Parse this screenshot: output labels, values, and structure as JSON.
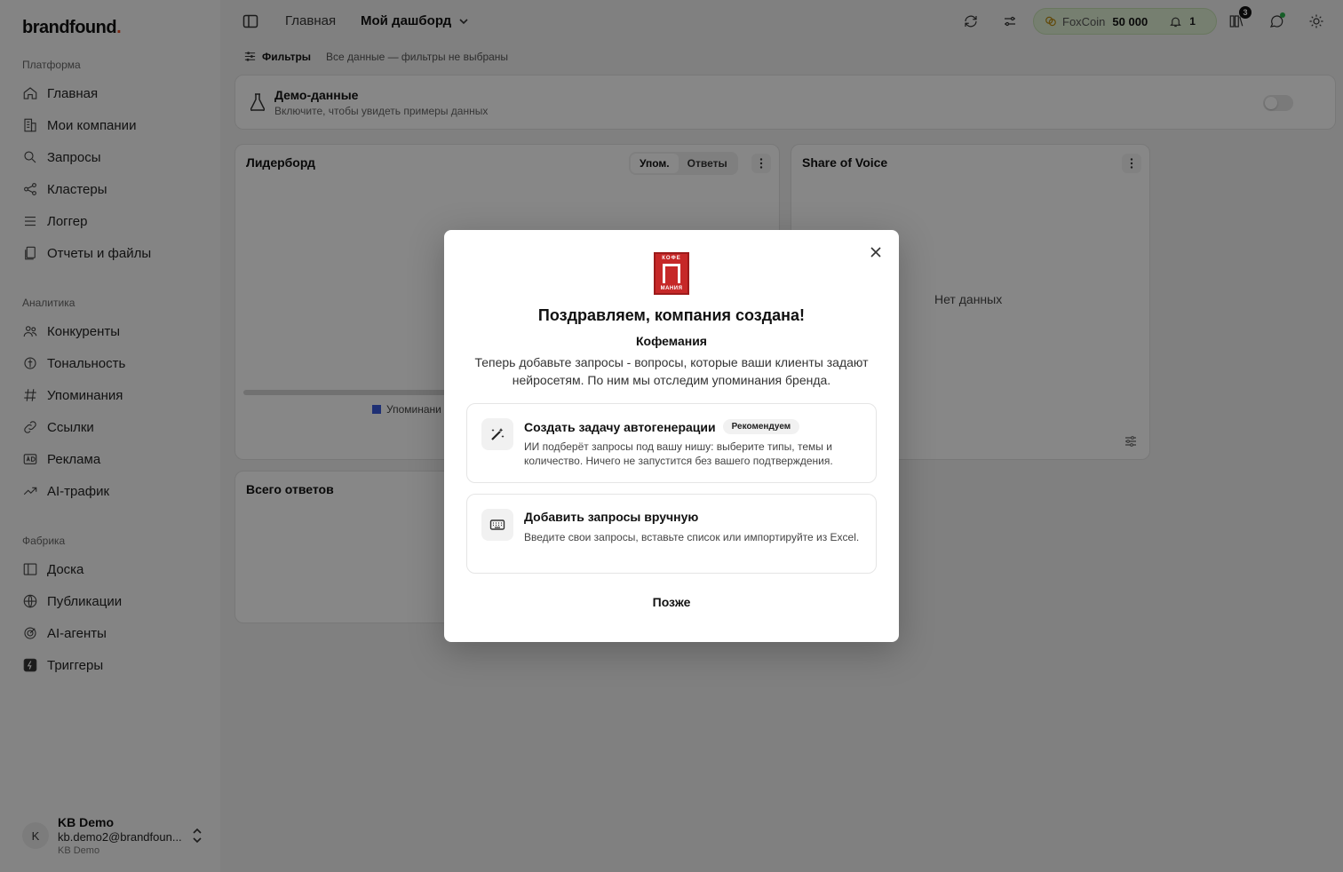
{
  "sidebar": {
    "logo": "brandfound",
    "logo_dot": ".",
    "sections": {
      "platform": "Платформа",
      "analytics": "Аналитика",
      "factory": "Фабрика"
    },
    "platform_items": [
      "Главная",
      "Мои компании",
      "Запросы",
      "Кластеры",
      "Логгер",
      "Отчеты и файлы"
    ],
    "analytics_items": [
      "Конкуренты",
      "Тональность",
      "Упоминания",
      "Ссылки",
      "Реклама",
      "AI-трафик"
    ],
    "factory_items": [
      "Доска",
      "Публикации",
      "AI-агенты",
      "Триггеры"
    ],
    "user": {
      "initial": "K",
      "name": "KB Demo",
      "email": "kb.demo2@brandfoun...",
      "org": "KB Demo"
    }
  },
  "topbar": {
    "breadcrumb_home": "Главная",
    "dashboard": "Мой дашборд",
    "coin_label": "FoxCoin",
    "coin_value": "50 000",
    "bell_count": "1",
    "reports_badge": "3"
  },
  "filters": {
    "label": "Фильтры",
    "note": "Все данные — фильтры не выбраны"
  },
  "demo": {
    "title": "Демо-данные",
    "subtitle": "Включите, чтобы увидеть примеры данных",
    "enabled": false
  },
  "leaderboard": {
    "title": "Лидерборд",
    "tabs": [
      "Упом.",
      "Ответы"
    ],
    "legend": "Упоминани"
  },
  "share_of_voice": {
    "title": "Share of Voice",
    "empty": "Нет данных"
  },
  "total_answers": {
    "title": "Всего ответов"
  },
  "modal": {
    "logo_top": "КОФЕ",
    "logo_bottom": "МАНИЯ",
    "title": "Поздравляем, компания создана!",
    "company": "Кофемания",
    "description": "Теперь добавьте запросы - вопросы, которые ваши клиенты задают нейросетям. По ним мы отследим упоминания бренда.",
    "options": [
      {
        "title": "Создать задачу автогенерации",
        "badge": "Рекомендуем",
        "subtitle": "ИИ подберёт запросы под вашу нишу: выберите типы, темы и количество. Ничего не запустится без вашего подтверждения.",
        "icon": "magic-wand-icon"
      },
      {
        "title": "Добавить запросы вручную",
        "subtitle": "Введите свои запросы, вставьте список или импортируйте из Excel.",
        "icon": "keyboard-icon"
      }
    ],
    "later": "Позже"
  },
  "colors": {
    "accent": "#e8502a",
    "coin_bg": "#dff0d4",
    "legend_blue": "#3b5bdb",
    "logo_red": "#c62828"
  }
}
